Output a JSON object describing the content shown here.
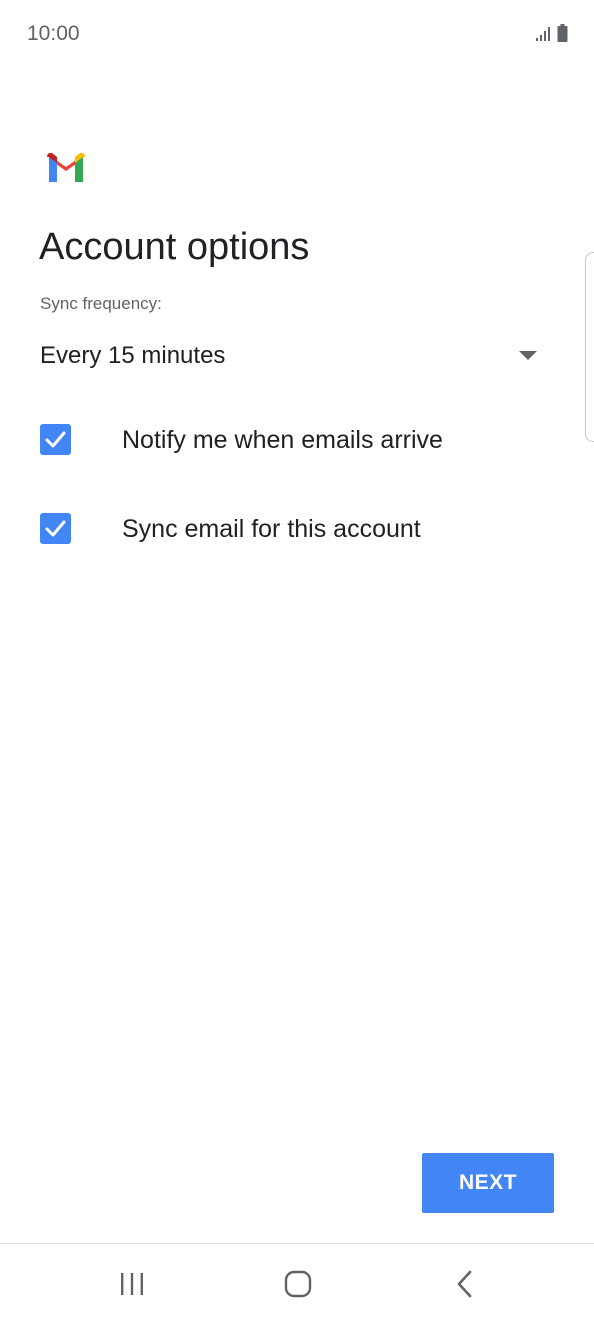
{
  "status_bar": {
    "time": "10:00",
    "icons": [
      "signal-icon",
      "battery-icon"
    ]
  },
  "app": {
    "logo": "gmail-logo-icon"
  },
  "page": {
    "title": "Account options"
  },
  "sync": {
    "label": "Sync frequency:",
    "selected": "Every 15 minutes",
    "dropdown_icon": "chevron-down-icon"
  },
  "options": [
    {
      "label": "Notify me when emails arrive",
      "checked": true
    },
    {
      "label": "Sync email for this account",
      "checked": true
    }
  ],
  "actions": {
    "next_label": "NEXT"
  },
  "nav_bar": {
    "buttons": [
      "recent-apps-icon",
      "home-icon",
      "back-icon"
    ]
  },
  "colors": {
    "accent": "#4285f4",
    "text_primary": "#202124",
    "text_secondary": "#5f6368"
  }
}
